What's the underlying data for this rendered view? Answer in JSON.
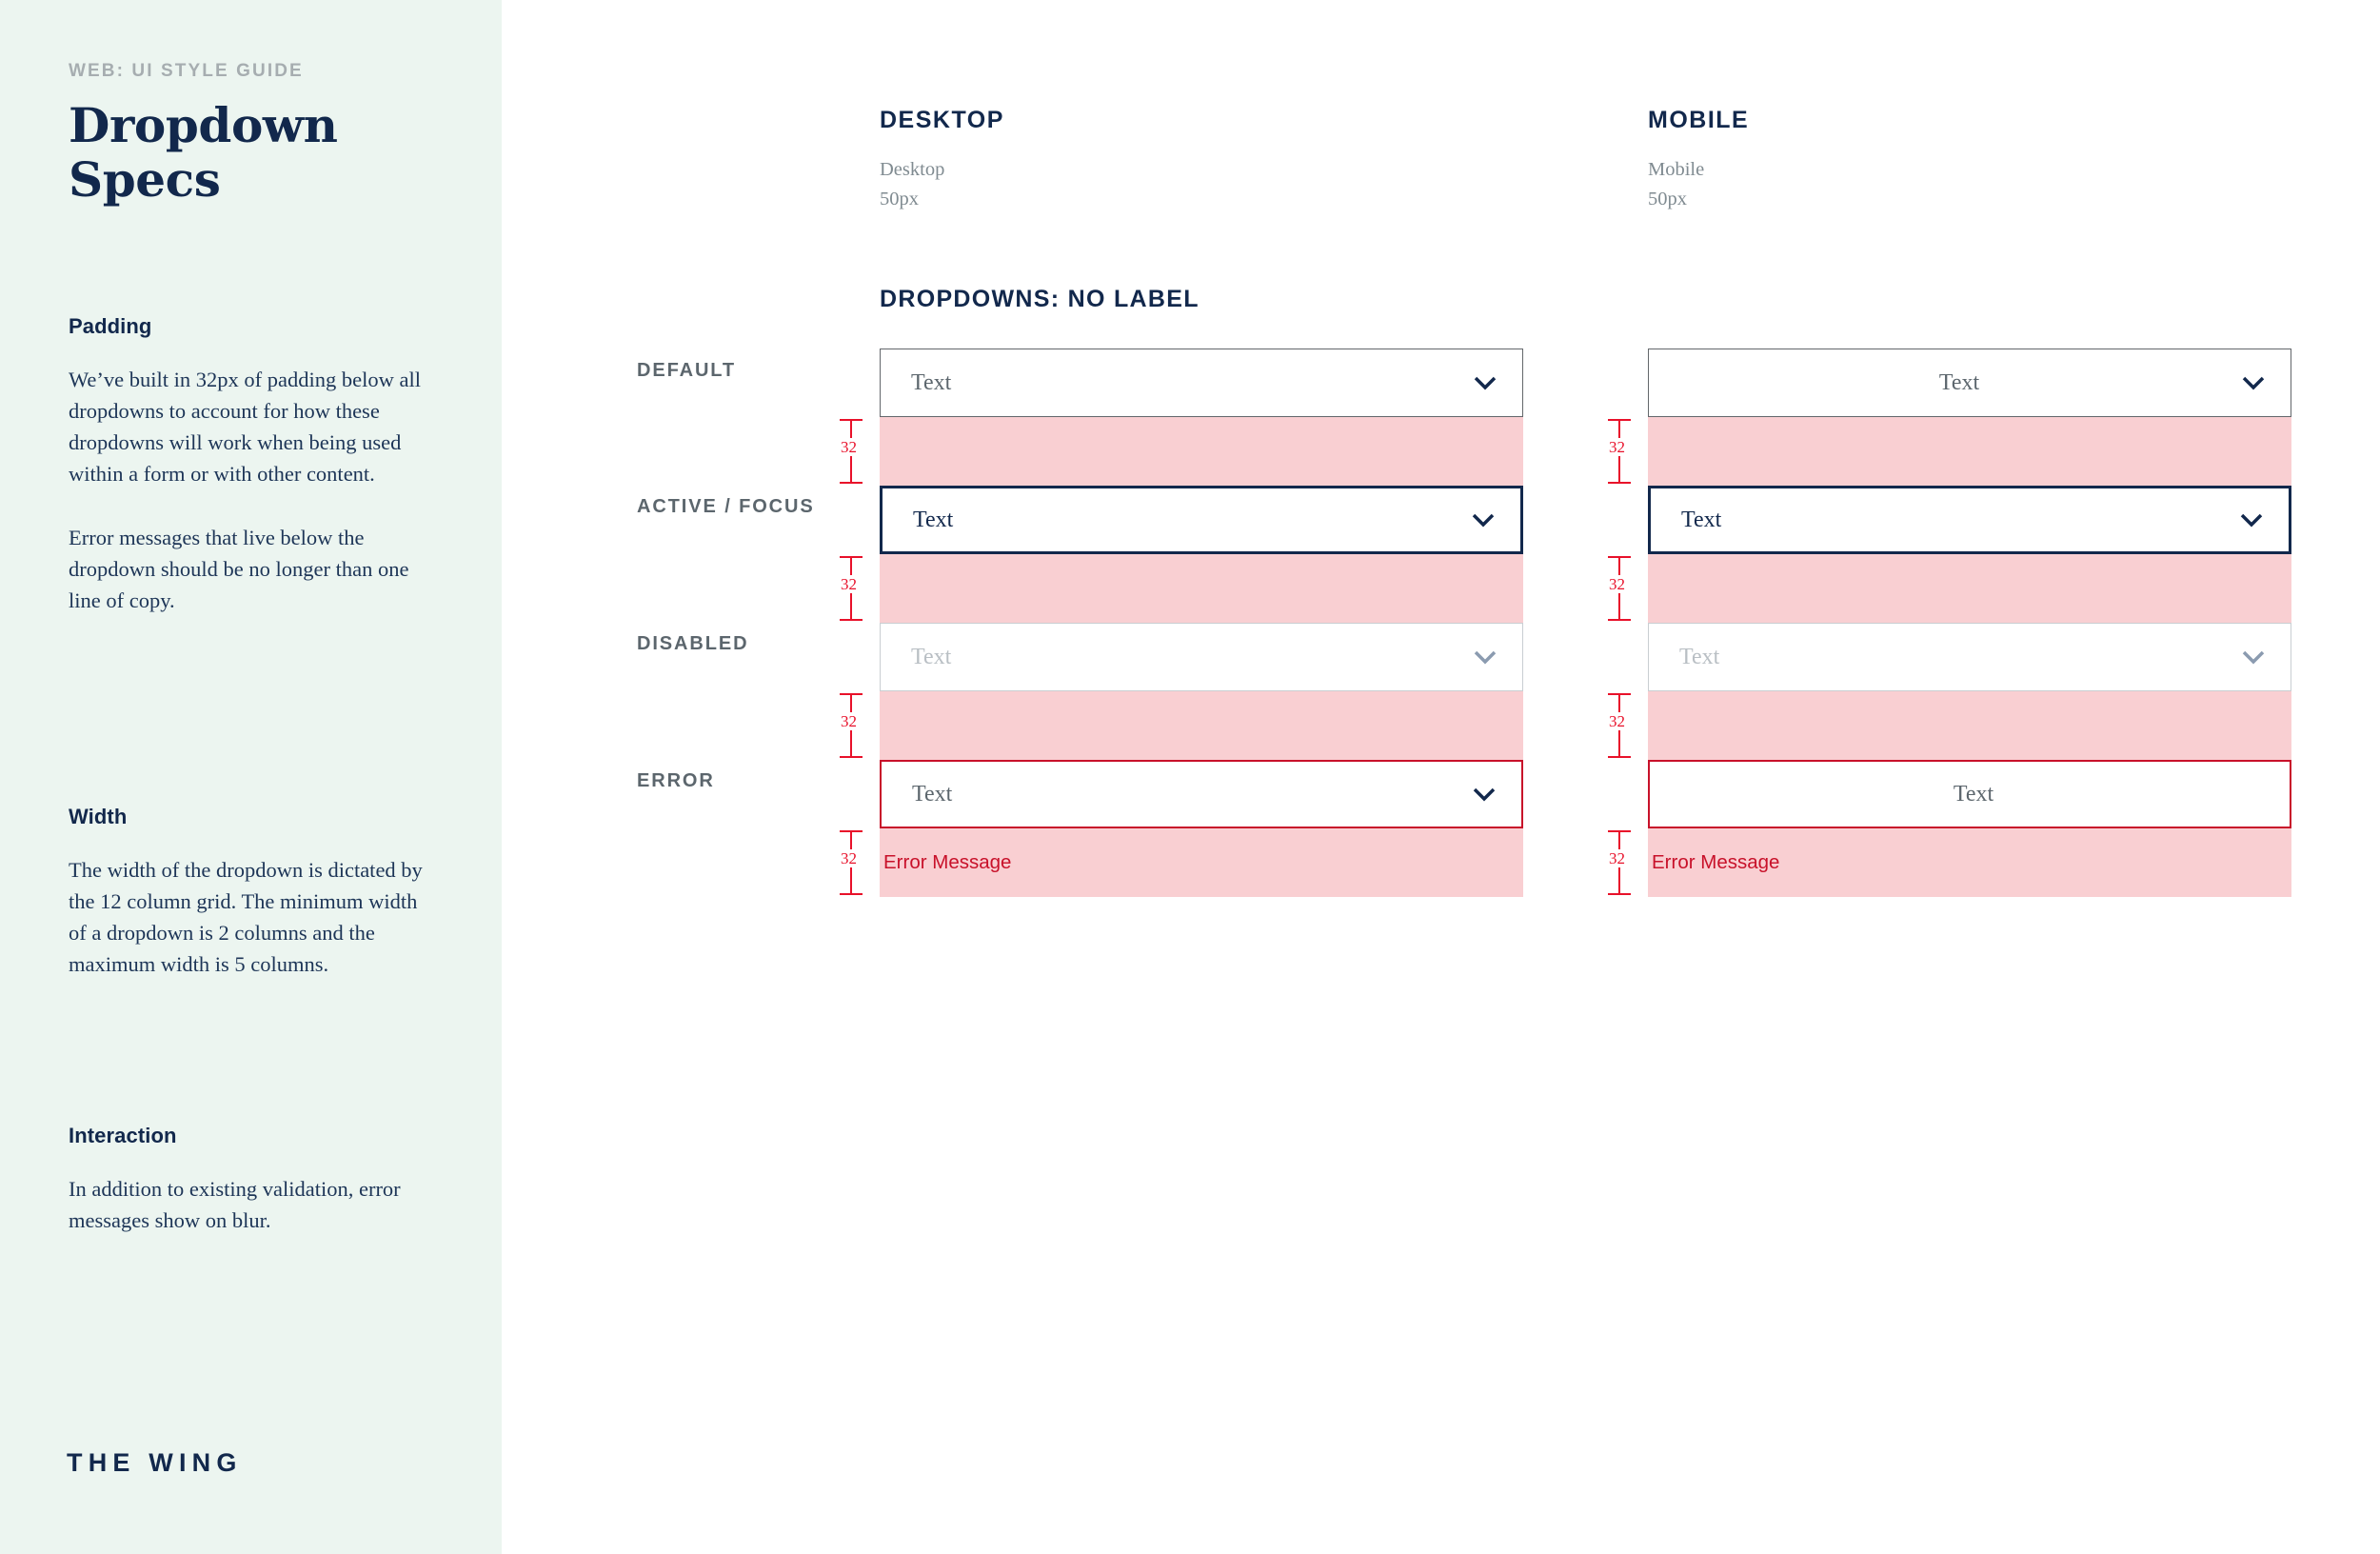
{
  "sidebar": {
    "eyebrow": "WEB: UI STYLE GUIDE",
    "title_line1": "Dropdown",
    "title_line2": "Specs",
    "sections": [
      {
        "heading": "Padding",
        "paragraphs": [
          "We’ve built in 32px of padding below all dropdowns to account for how these dropdowns will work when being used within a form or with other content.",
          "Error messages that live below the dropdown should be no longer than one line of copy."
        ]
      },
      {
        "heading": "Width",
        "paragraphs": [
          "The width of the dropdown is dictated by the 12 column grid. The minimum width of a dropdown is 2 columns and the maximum width is 5 columns."
        ]
      },
      {
        "heading": "Interaction",
        "paragraphs": [
          "In addition to existing validation, error messages show on blur."
        ]
      }
    ],
    "brand": "THE WING"
  },
  "main": {
    "section_title": "DROPDOWNS: NO LABEL",
    "columns": [
      {
        "title": "DESKTOP",
        "sub_line1": "Desktop",
        "sub_line2": "50px"
      },
      {
        "title": "MOBILE",
        "sub_line1": "Mobile",
        "sub_line2": "50px"
      }
    ],
    "state_labels": [
      "DEFAULT",
      "ACTIVE / FOCUS",
      "DISABLED",
      "ERROR"
    ],
    "measure_label": "32",
    "desktop_rows": [
      {
        "state": "default",
        "text": "Text",
        "align": "left",
        "chevron": true
      },
      {
        "state": "active",
        "text": "Text",
        "align": "left",
        "chevron": true
      },
      {
        "state": "disabled",
        "text": "Text",
        "align": "left",
        "chevron": true
      },
      {
        "state": "error",
        "text": "Text",
        "align": "left",
        "chevron": true
      }
    ],
    "mobile_rows": [
      {
        "state": "default",
        "text": "Text",
        "align": "center",
        "chevron": true
      },
      {
        "state": "active",
        "text": "Text",
        "align": "left",
        "chevron": true
      },
      {
        "state": "disabled",
        "text": "Text",
        "align": "left",
        "chevron": true
      },
      {
        "state": "error",
        "text": "Text",
        "align": "center",
        "chevron": false
      }
    ],
    "error_message": "Error Message"
  },
  "colors": {
    "sidebar_bg": "#ecf5f0",
    "navy": "#12284c",
    "pink_padding": "#f9cfd2",
    "error_red": "#c8112a",
    "measure_red": "#e8112a",
    "gray_border": "#63676b",
    "disabled_border": "#c9ced2",
    "disabled_text": "#b9bfc4"
  }
}
